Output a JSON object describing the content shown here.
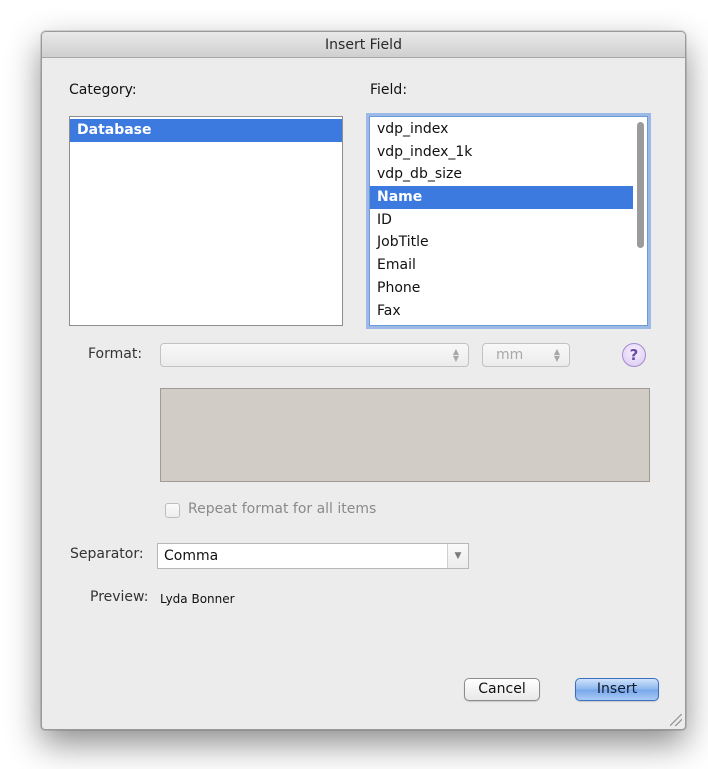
{
  "dialog": {
    "title": "Insert Field",
    "category_label": "Category:",
    "field_label": "Field:",
    "categories": [
      {
        "label": "Database",
        "selected": true
      }
    ],
    "fields": [
      {
        "label": "vdp_index",
        "selected": false
      },
      {
        "label": "vdp_index_1k",
        "selected": false
      },
      {
        "label": "vdp_db_size",
        "selected": false
      },
      {
        "label": "Name",
        "selected": true
      },
      {
        "label": "ID",
        "selected": false
      },
      {
        "label": "JobTitle",
        "selected": false
      },
      {
        "label": "Email",
        "selected": false
      },
      {
        "label": "Phone",
        "selected": false
      },
      {
        "label": "Fax",
        "selected": false
      }
    ],
    "format_label": "Format:",
    "format_value": "",
    "unit_value": "mm",
    "help_glyph": "?",
    "repeat_label": "Repeat format for all items",
    "repeat_checked": false,
    "separator_label": "Separator:",
    "separator_value": "Comma",
    "preview_label": "Preview:",
    "preview_value": "Lyda Bonner",
    "cancel_label": "Cancel",
    "insert_label": "Insert"
  },
  "icons": {
    "stepper": "up-down-arrows",
    "combo_arrow": "chevron-down",
    "help": "question-mark",
    "resize": "resize-grip"
  },
  "colors": {
    "selection": "#3d7ae0",
    "focus_ring": "#5c92e1",
    "default_button": "#77a6ea",
    "well": "#d2ccc6"
  }
}
